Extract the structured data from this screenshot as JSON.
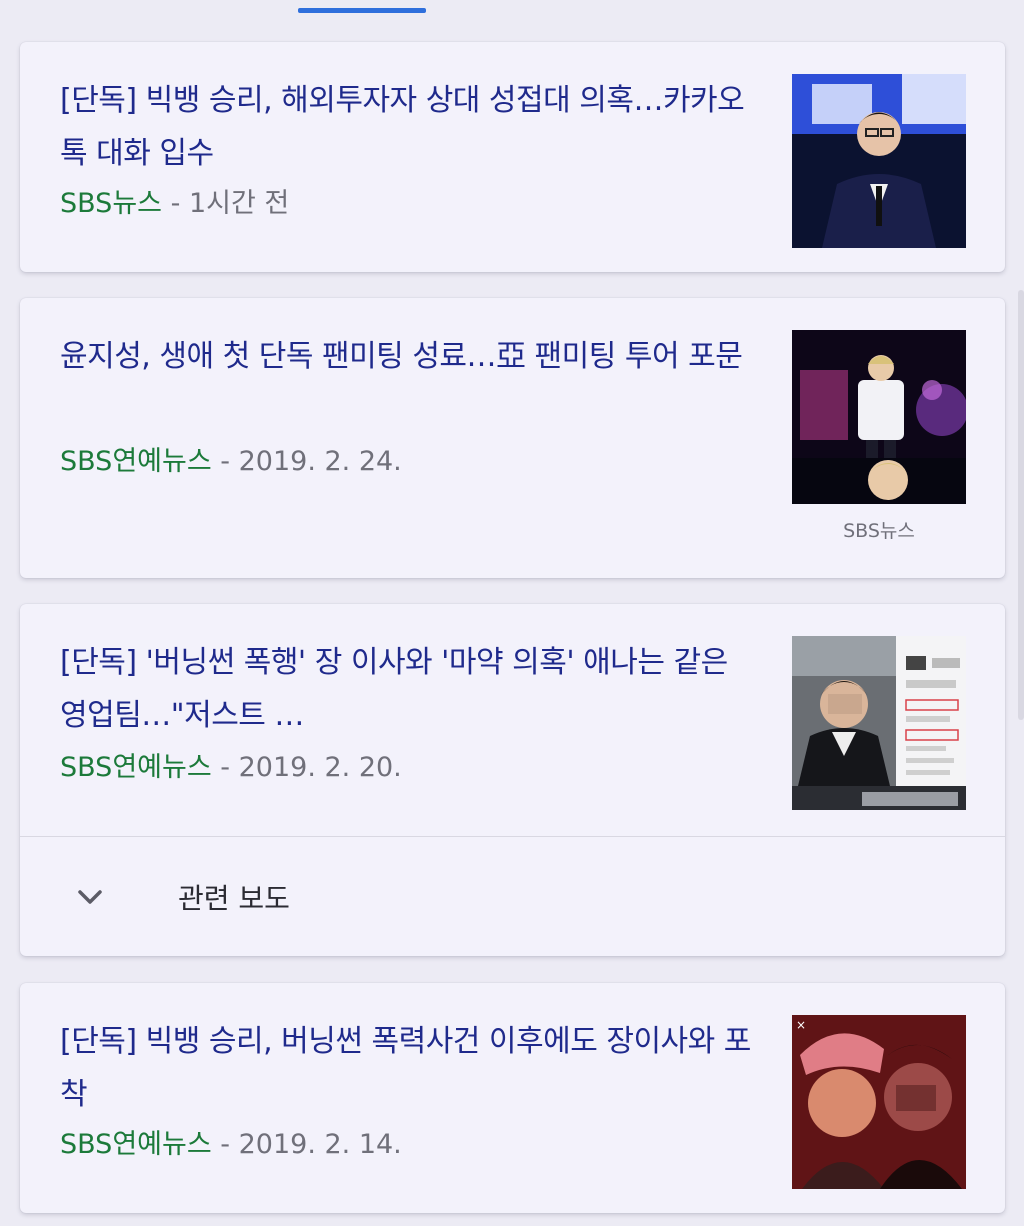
{
  "header": {
    "active_tab_color": "#2f6fdc"
  },
  "articles": [
    {
      "headline": "[단독] 빅뱅 승리, 해외투자자 상대 성접대 의혹…카카오톡 대화 입수",
      "source": "SBS뉴스",
      "separator": " - ",
      "date": "1시간 전",
      "thumbnail": "performer-suit-photo"
    },
    {
      "headline": "윤지성, 생애 첫 단독 팬미팅 성료…亞 팬미팅 투어 포문",
      "source": "SBS연예뉴스",
      "separator": " - ",
      "date": "2019. 2. 24.",
      "thumbnail": "fanmeeting-stage-photo",
      "thumbnail_caption": "SBS뉴스"
    },
    {
      "headline": "[단독] '버닝썬 폭행' 장 이사와 '마약 의혹' 애나는 같은 영업팀…\"저스트 …",
      "source": "SBS연예뉴스",
      "separator": " - ",
      "date": "2019. 2. 20.",
      "thumbnail": "blurred-person-document-photo"
    },
    {
      "headline": "[단독] 빅뱅 승리, 버닝썬 폭력사건 이후에도 장이사와 포착",
      "source": "SBS연예뉴스",
      "separator": " - ",
      "date": "2019. 2. 14.",
      "thumbnail": "selfie-red-light-photo"
    }
  ],
  "related": {
    "label": "관련 보도",
    "icon": "chevron-down-icon"
  },
  "colors": {
    "background": "#ecebf4",
    "card": "#f3f2fb",
    "headline": "#1f2a8c",
    "source": "#1c7a3a",
    "date": "#70707a"
  }
}
